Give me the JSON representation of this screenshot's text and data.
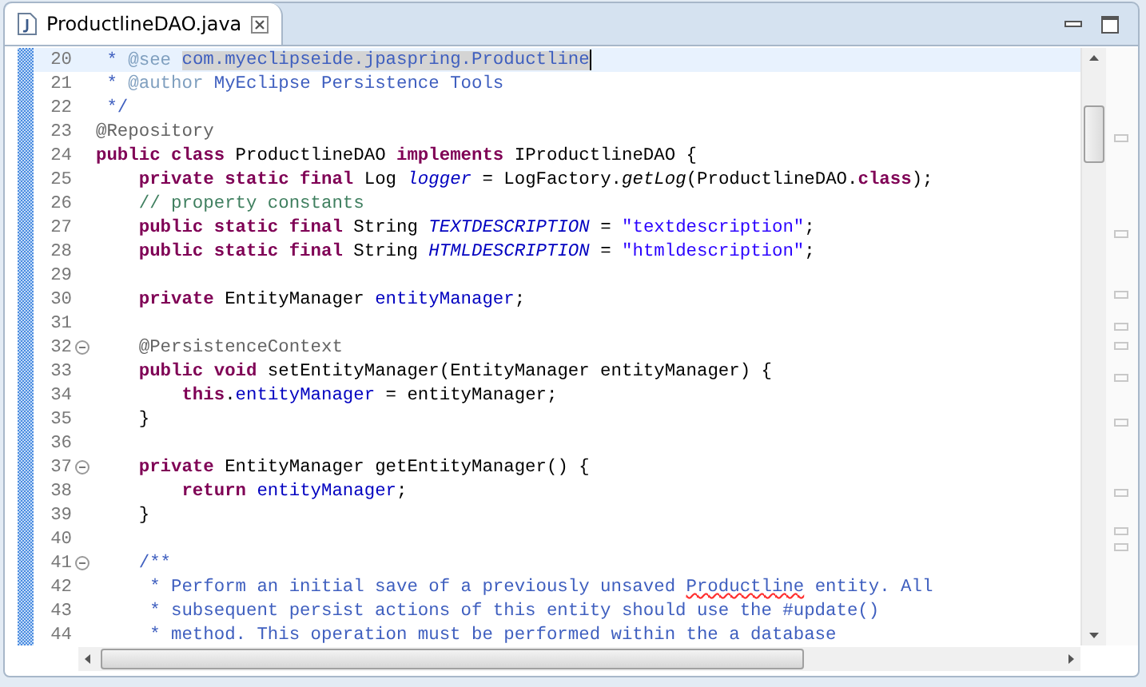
{
  "tab": {
    "title": "ProductlineDAO.java"
  },
  "editor": {
    "lines": [
      {
        "number": "20",
        "current": true,
        "foldable": false,
        "tokens": [
          {
            "kind": "javadoc",
            "text": " * "
          },
          {
            "kind": "javadoc-tag",
            "text": "@see "
          },
          {
            "kind": "javadoc-selected",
            "text": "com.myeclipseide.jpaspring.Productline"
          }
        ]
      },
      {
        "number": "21",
        "current": false,
        "foldable": false,
        "tokens": [
          {
            "kind": "javadoc",
            "text": " * "
          },
          {
            "kind": "javadoc-tag",
            "text": "@author"
          },
          {
            "kind": "javadoc",
            "text": " MyEclipse Persistence Tools"
          }
        ]
      },
      {
        "number": "22",
        "current": false,
        "foldable": false,
        "tokens": [
          {
            "kind": "javadoc",
            "text": " */"
          }
        ]
      },
      {
        "number": "23",
        "current": false,
        "foldable": false,
        "tokens": [
          {
            "kind": "annotation",
            "text": "@Repository"
          }
        ]
      },
      {
        "number": "24",
        "current": false,
        "foldable": false,
        "tokens": [
          {
            "kind": "keyword",
            "text": "public class"
          },
          {
            "kind": "plain",
            "text": " ProductlineDAO "
          },
          {
            "kind": "keyword",
            "text": "implements"
          },
          {
            "kind": "plain",
            "text": " IProductlineDAO {"
          }
        ]
      },
      {
        "number": "25",
        "current": false,
        "foldable": false,
        "tokens": [
          {
            "kind": "keyword",
            "text": "    private static final"
          },
          {
            "kind": "plain",
            "text": " Log "
          },
          {
            "kind": "static-field",
            "text": "logger"
          },
          {
            "kind": "plain",
            "text": " = LogFactory."
          },
          {
            "kind": "static-method",
            "text": "getLog"
          },
          {
            "kind": "plain",
            "text": "(ProductlineDAO."
          },
          {
            "kind": "keyword",
            "text": "class"
          },
          {
            "kind": "plain",
            "text": ");"
          }
        ]
      },
      {
        "number": "26",
        "current": false,
        "foldable": false,
        "tokens": [
          {
            "kind": "comment",
            "text": "    // property constants"
          }
        ]
      },
      {
        "number": "27",
        "current": false,
        "foldable": false,
        "tokens": [
          {
            "kind": "keyword",
            "text": "    public static final"
          },
          {
            "kind": "plain",
            "text": " String "
          },
          {
            "kind": "static-field",
            "text": "TEXTDESCRIPTION"
          },
          {
            "kind": "plain",
            "text": " = "
          },
          {
            "kind": "string",
            "text": "\"textdescription\""
          },
          {
            "kind": "plain",
            "text": ";"
          }
        ]
      },
      {
        "number": "28",
        "current": false,
        "foldable": false,
        "tokens": [
          {
            "kind": "keyword",
            "text": "    public static final"
          },
          {
            "kind": "plain",
            "text": " String "
          },
          {
            "kind": "static-field",
            "text": "HTMLDESCRIPTION"
          },
          {
            "kind": "plain",
            "text": " = "
          },
          {
            "kind": "string",
            "text": "\"htmldescription\""
          },
          {
            "kind": "plain",
            "text": ";"
          }
        ]
      },
      {
        "number": "29",
        "current": false,
        "foldable": false
      },
      {
        "number": "30",
        "current": false,
        "foldable": false,
        "tokens": [
          {
            "kind": "keyword",
            "text": "    private"
          },
          {
            "kind": "plain",
            "text": " EntityManager "
          },
          {
            "kind": "field",
            "text": "entityManager"
          },
          {
            "kind": "plain",
            "text": ";"
          }
        ]
      },
      {
        "number": "31",
        "current": false,
        "foldable": false
      },
      {
        "number": "32",
        "current": false,
        "foldable": true,
        "tokens": [
          {
            "kind": "annotation",
            "text": "    @PersistenceContext"
          }
        ]
      },
      {
        "number": "33",
        "current": false,
        "foldable": false,
        "tokens": [
          {
            "kind": "keyword",
            "text": "    public void"
          },
          {
            "kind": "plain",
            "text": " setEntityManager(EntityManager entityManager) {"
          }
        ]
      },
      {
        "number": "34",
        "current": false,
        "foldable": false,
        "tokens": [
          {
            "kind": "keyword",
            "text": "        this"
          },
          {
            "kind": "plain",
            "text": "."
          },
          {
            "kind": "field",
            "text": "entityManager"
          },
          {
            "kind": "plain",
            "text": " = entityManager;"
          }
        ]
      },
      {
        "number": "35",
        "current": false,
        "foldable": false,
        "tokens": [
          {
            "kind": "plain",
            "text": "    }"
          }
        ]
      },
      {
        "number": "36",
        "current": false,
        "foldable": false
      },
      {
        "number": "37",
        "current": false,
        "foldable": true,
        "tokens": [
          {
            "kind": "keyword",
            "text": "    private"
          },
          {
            "kind": "plain",
            "text": " EntityManager getEntityManager() {"
          }
        ]
      },
      {
        "number": "38",
        "current": false,
        "foldable": false,
        "tokens": [
          {
            "kind": "keyword",
            "text": "        return"
          },
          {
            "kind": "field",
            "text": " entityManager"
          },
          {
            "kind": "plain",
            "text": ";"
          }
        ]
      },
      {
        "number": "39",
        "current": false,
        "foldable": false,
        "tokens": [
          {
            "kind": "plain",
            "text": "    }"
          }
        ]
      },
      {
        "number": "40",
        "current": false,
        "foldable": false
      },
      {
        "number": "41",
        "current": false,
        "foldable": true,
        "tokens": [
          {
            "kind": "javadoc",
            "text": "    /**"
          }
        ]
      },
      {
        "number": "42",
        "current": false,
        "foldable": false,
        "tokens": [
          {
            "kind": "javadoc",
            "text": "     * Perform an initial save of a previously unsaved "
          },
          {
            "kind": "javadoc-misspelled",
            "text": "Productline"
          },
          {
            "kind": "javadoc",
            "text": " entity. All"
          }
        ]
      },
      {
        "number": "43",
        "current": false,
        "foldable": false,
        "tokens": [
          {
            "kind": "javadoc",
            "text": "     * subsequent persist actions of this entity should use the #update()"
          }
        ]
      },
      {
        "number": "44",
        "current": false,
        "foldable": false,
        "tokens": [
          {
            "kind": "javadoc",
            "text": "     * method. This operation must be performed within the a database"
          }
        ]
      }
    ]
  }
}
